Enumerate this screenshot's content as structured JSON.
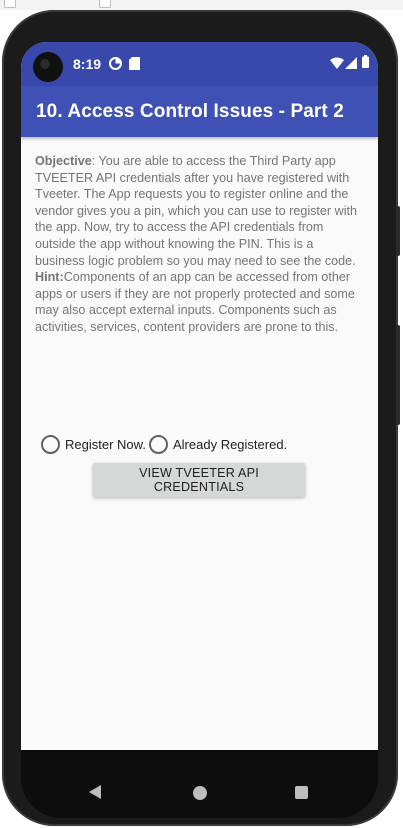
{
  "status_bar": {
    "time": "8:19",
    "icons": [
      "data-saver-icon",
      "sd-card-icon",
      "wifi-icon",
      "cell-signal-icon",
      "battery-icon"
    ]
  },
  "app_bar": {
    "title": "10. Access Control Issues - Part 2"
  },
  "description": {
    "objective_label": "Objective",
    "objective_text": ": You are able to access the Third Party app TVEETER API credentials after you have registered with Tveeter. The App requests you to register online and the vendor gives you a pin, which you can use to register with the app. Now, try to access the API credentials from outside the app without knowing the PIN. This is a business logic problem so you may need to see the code. ",
    "hint_label": "Hint:",
    "hint_text": "Components of an app can be accessed from other apps or users if they are not properly protected and some may also accept external inputs. Components such as activities, services, content providers are prone to this."
  },
  "registration": {
    "option_register": "Register Now.",
    "option_registered": "Already Registered.",
    "selected": null
  },
  "actions": {
    "view_credentials_label": "VIEW TVEETER API CREDENTIALS"
  },
  "colors": {
    "status_bar": "#3949ab",
    "app_bar": "#3f51b5",
    "background": "#fafafa",
    "body_text": "#757575",
    "button": "#d6d7d7"
  }
}
